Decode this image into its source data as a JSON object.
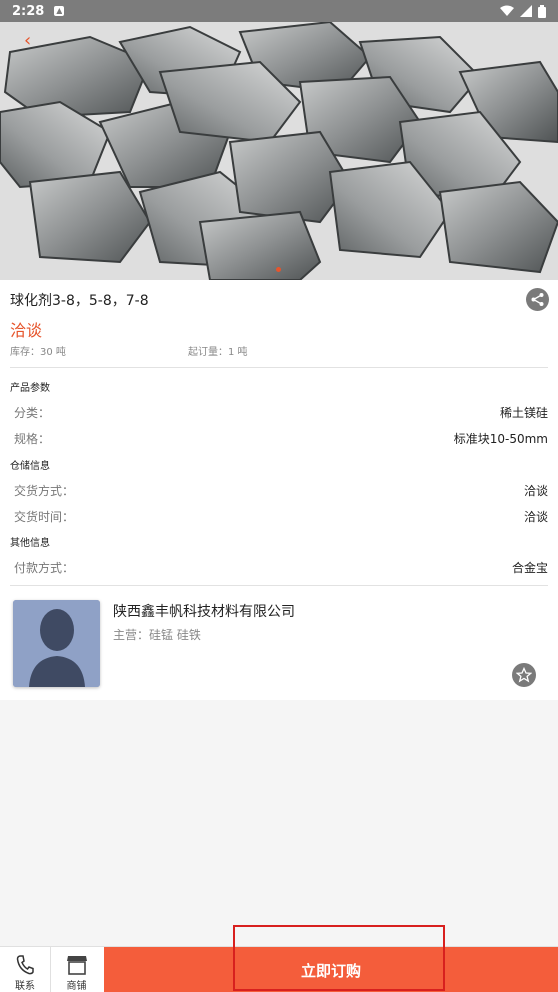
{
  "statusbar": {
    "time": "2:28"
  },
  "product": {
    "title": "球化剂3-8，5-8，7-8",
    "price": "洽谈",
    "stock": "库存：30 吨",
    "min_order": "起订量：1 吨"
  },
  "params": {
    "header": "产品参数",
    "rows": [
      {
        "label": "分类：",
        "value": "稀土镁硅"
      },
      {
        "label": "规格：",
        "value": "标准块10-50mm"
      }
    ]
  },
  "storage": {
    "header": "仓储信息",
    "rows": [
      {
        "label": "交货方式：",
        "value": "洽谈"
      },
      {
        "label": "交货时间：",
        "value": "洽谈"
      }
    ]
  },
  "other": {
    "header": "其他信息",
    "rows": [
      {
        "label": "付款方式：",
        "value": "合金宝"
      }
    ]
  },
  "company": {
    "name": "陕西鑫丰帆科技材料有限公司",
    "main": "主营：硅锰 硅铁"
  },
  "bottom_bar": {
    "contact_label": "联系",
    "shop_label": "商铺",
    "buy_label": "立即订购"
  },
  "colors": {
    "accent": "#f45d3b",
    "price": "#e6552c",
    "highlight": "#d8201e"
  },
  "icons": [
    "back-arrow-icon",
    "share-icon",
    "star-icon",
    "phone-icon",
    "shop-icon",
    "wifi-icon",
    "signal-icon",
    "battery-icon"
  ]
}
